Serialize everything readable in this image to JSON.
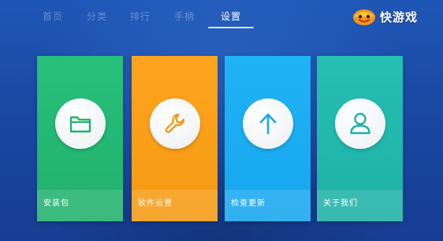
{
  "nav": {
    "tabs": [
      {
        "label": "首页"
      },
      {
        "label": "分类"
      },
      {
        "label": "排行"
      },
      {
        "label": "手柄"
      },
      {
        "label": "设置"
      }
    ],
    "active_index": 4
  },
  "brand": {
    "name": "快游戏",
    "logo_icon": "smiling-face-logo-icon"
  },
  "cards": [
    {
      "label": "安装包",
      "icon": "folder-icon",
      "color": "#20b16d"
    },
    {
      "label": "软件设置",
      "icon": "wrench-icon",
      "color": "#f49a12"
    },
    {
      "label": "检查更新",
      "icon": "arrow-up-icon",
      "color": "#17a6ee"
    },
    {
      "label": "关于我们",
      "icon": "user-icon",
      "color": "#1eb1a6"
    }
  ],
  "colors": {
    "background": "#1a48a3",
    "active_tab": "#ffffff",
    "inactive_tab": "rgba(255,255,255,0.32)"
  }
}
